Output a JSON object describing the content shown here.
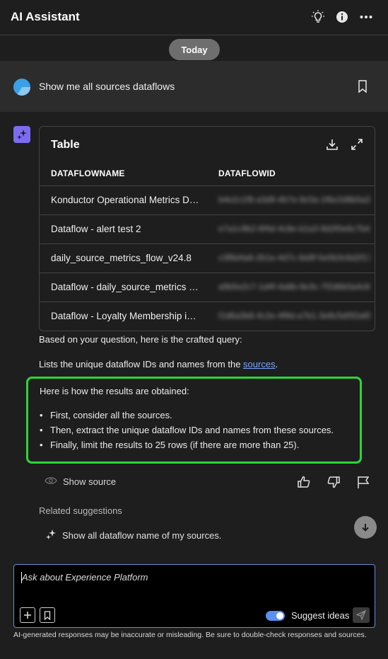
{
  "header": {
    "title": "AI Assistant",
    "icons": [
      "lightbulb-icon",
      "info-icon",
      "more-icon"
    ]
  },
  "date_separator": "Today",
  "user_message": {
    "text": "Show me all sources dataflows",
    "icon": "bookmark-icon"
  },
  "table": {
    "title": "Table",
    "columns": [
      "DATAFLOWNAME",
      "DATAFLOWID"
    ],
    "rows": [
      {
        "name": "Konductor Operational Metrics Data",
        "id": "b4e2c1f8-a3d9-4b7e-9c0a-1f6e2d8b5a31"
      },
      {
        "name": "Dataflow - alert test 2",
        "id": "e7a1c9b2-6f4d-4c8e-b1a3-9d2f0e6c7b48"
      },
      {
        "name": "daily_source_metrics_flow_v24.8",
        "id": "c3f8d4a6-2b1e-4d7c-8a9f-5e0b3c6d2f17"
      },
      {
        "name": "Dataflow - daily_source_metrics - redacted",
        "id": "a9b5e2c7-1d4f-4a8b-9e3c-7f2d6b0a4c85"
      },
      {
        "name": "Dataflow - Loyalty Membership info",
        "id": "f1d6a3b8-4c2e-4f9d-a7b1-3e8c5d0f2a69"
      }
    ],
    "icons": [
      "download-icon",
      "expand-icon"
    ]
  },
  "response": {
    "intro": "Based on your question, here is the crafted query:",
    "summary_prefix": "Lists the unique dataflow IDs and names from the ",
    "summary_link": "sources",
    "summary_suffix": ".",
    "steps_heading": "Here is how the results are obtained:",
    "steps": [
      "First, consider all the sources.",
      "Then, extract the unique dataflow IDs and names from these sources.",
      "Finally, limit the results to 25 rows (if there are more than 25)."
    ],
    "show_source": "Show source"
  },
  "related": {
    "heading": "Related suggestions",
    "items": [
      "Show all dataflow name of my sources."
    ]
  },
  "composer": {
    "placeholder": "Ask about Experience Platform",
    "suggest_label": "Suggest ideas",
    "suggest_enabled": true
  },
  "disclaimer": "AI-generated responses may be inaccurate or misleading. Be sure to double-check responses and sources.",
  "colors": {
    "background": "#1e1e1e",
    "highlight_border": "#2ed43a",
    "accent": "#5b8ff0",
    "ai_badge": "#7c6cf0",
    "link": "#7ba4ff"
  }
}
